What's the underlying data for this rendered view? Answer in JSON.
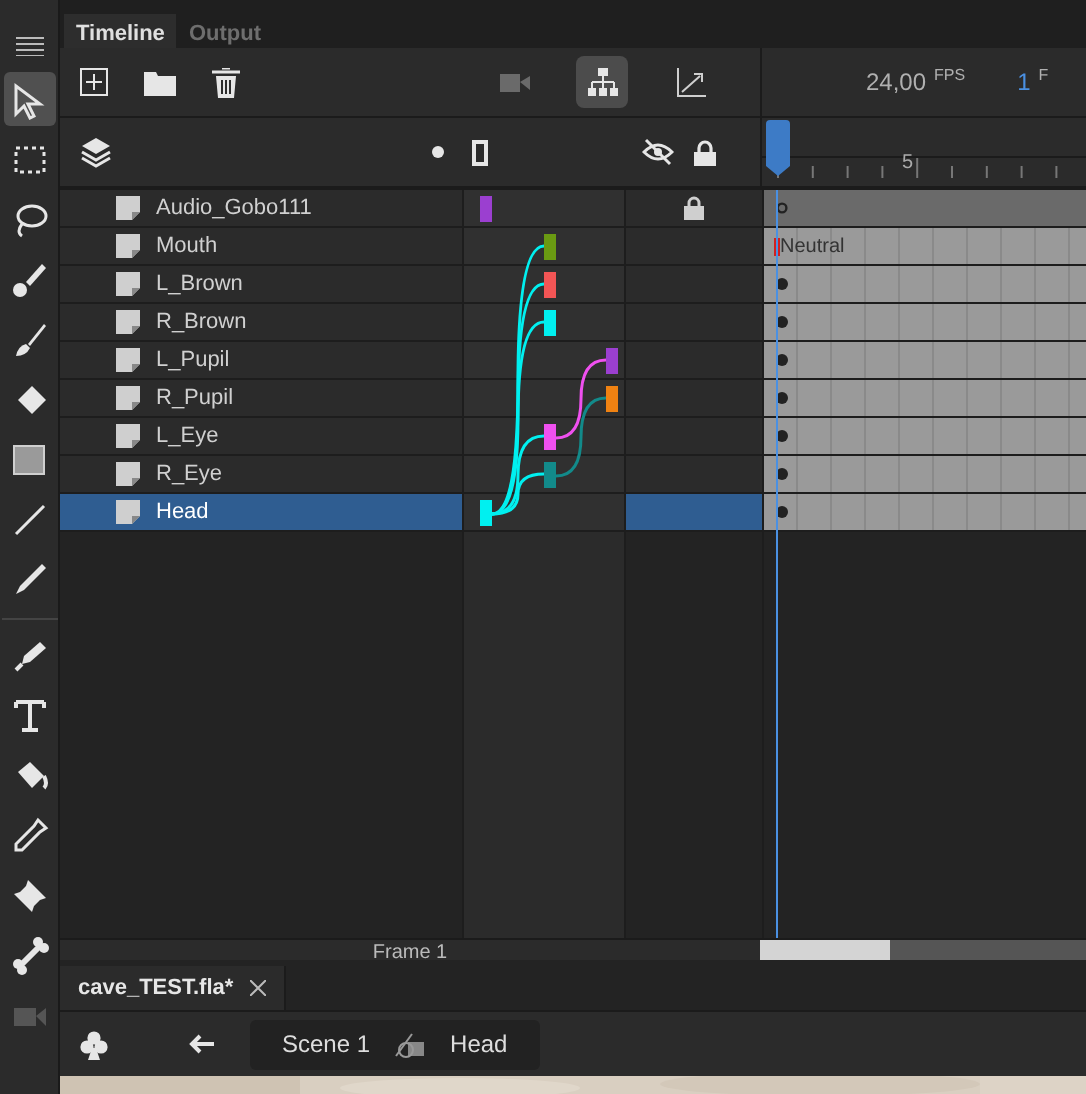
{
  "tools": [
    {
      "selected": true
    },
    {
      "selected": false
    },
    {
      "selected": false
    },
    {
      "selected": false
    },
    {
      "selected": false
    },
    {
      "selected": false
    },
    {
      "selected": false
    },
    {
      "selected": false
    },
    {
      "selected": false
    },
    {
      "selected": false
    },
    {
      "selected": false
    },
    {
      "selected": false
    },
    {
      "selected": false
    },
    {
      "selected": false
    },
    {
      "selected": false
    },
    {
      "selected": false
    }
  ],
  "tabs": [
    {
      "label": "Timeline",
      "selected": true
    },
    {
      "label": "Output",
      "selected": false
    }
  ],
  "view_buttons": [
    {
      "selected": false
    },
    {
      "selected": true
    },
    {
      "selected": false
    }
  ],
  "fps": {
    "value": "24,00",
    "unit": "FPS"
  },
  "frame": {
    "value": "1",
    "unit": "F"
  },
  "ruler": {
    "tick_label": "5"
  },
  "layers": [
    {
      "name": "Audio_Gobo111",
      "selected": false,
      "locked": true,
      "kind": "root",
      "color": "#9b3fd0",
      "keyframe_filled": false
    },
    {
      "name": "Mouth",
      "selected": false,
      "locked": false,
      "kind": "child",
      "color": "#6a9a12",
      "frame_label": "Neutral"
    },
    {
      "name": "L_Brown",
      "selected": false,
      "locked": false,
      "kind": "child",
      "color": "#f25555",
      "keyframe_filled": true
    },
    {
      "name": "R_Brown",
      "selected": false,
      "locked": false,
      "kind": "child",
      "color": "#00f0f0",
      "keyframe_filled": true
    },
    {
      "name": "L_Pupil",
      "selected": false,
      "locked": false,
      "kind": "grandchild",
      "color": "#9b3fd0",
      "keyframe_filled": true
    },
    {
      "name": "R_Pupil",
      "selected": false,
      "locked": false,
      "kind": "grandchild",
      "color": "#f08212",
      "keyframe_filled": true
    },
    {
      "name": "L_Eye",
      "selected": false,
      "locked": false,
      "kind": "child",
      "color": "#f050f0",
      "keyframe_filled": true
    },
    {
      "name": "R_Eye",
      "selected": false,
      "locked": false,
      "kind": "child",
      "color": "#128a8a",
      "keyframe_filled": true
    },
    {
      "name": "Head",
      "selected": true,
      "locked": false,
      "kind": "root",
      "color": "#00f0f0",
      "keyframe_filled": true
    }
  ],
  "status": "Frame 1",
  "document_tab": {
    "title": "cave_TEST.fla*"
  },
  "breadcrumbs": [
    "Scene 1",
    "Head"
  ]
}
